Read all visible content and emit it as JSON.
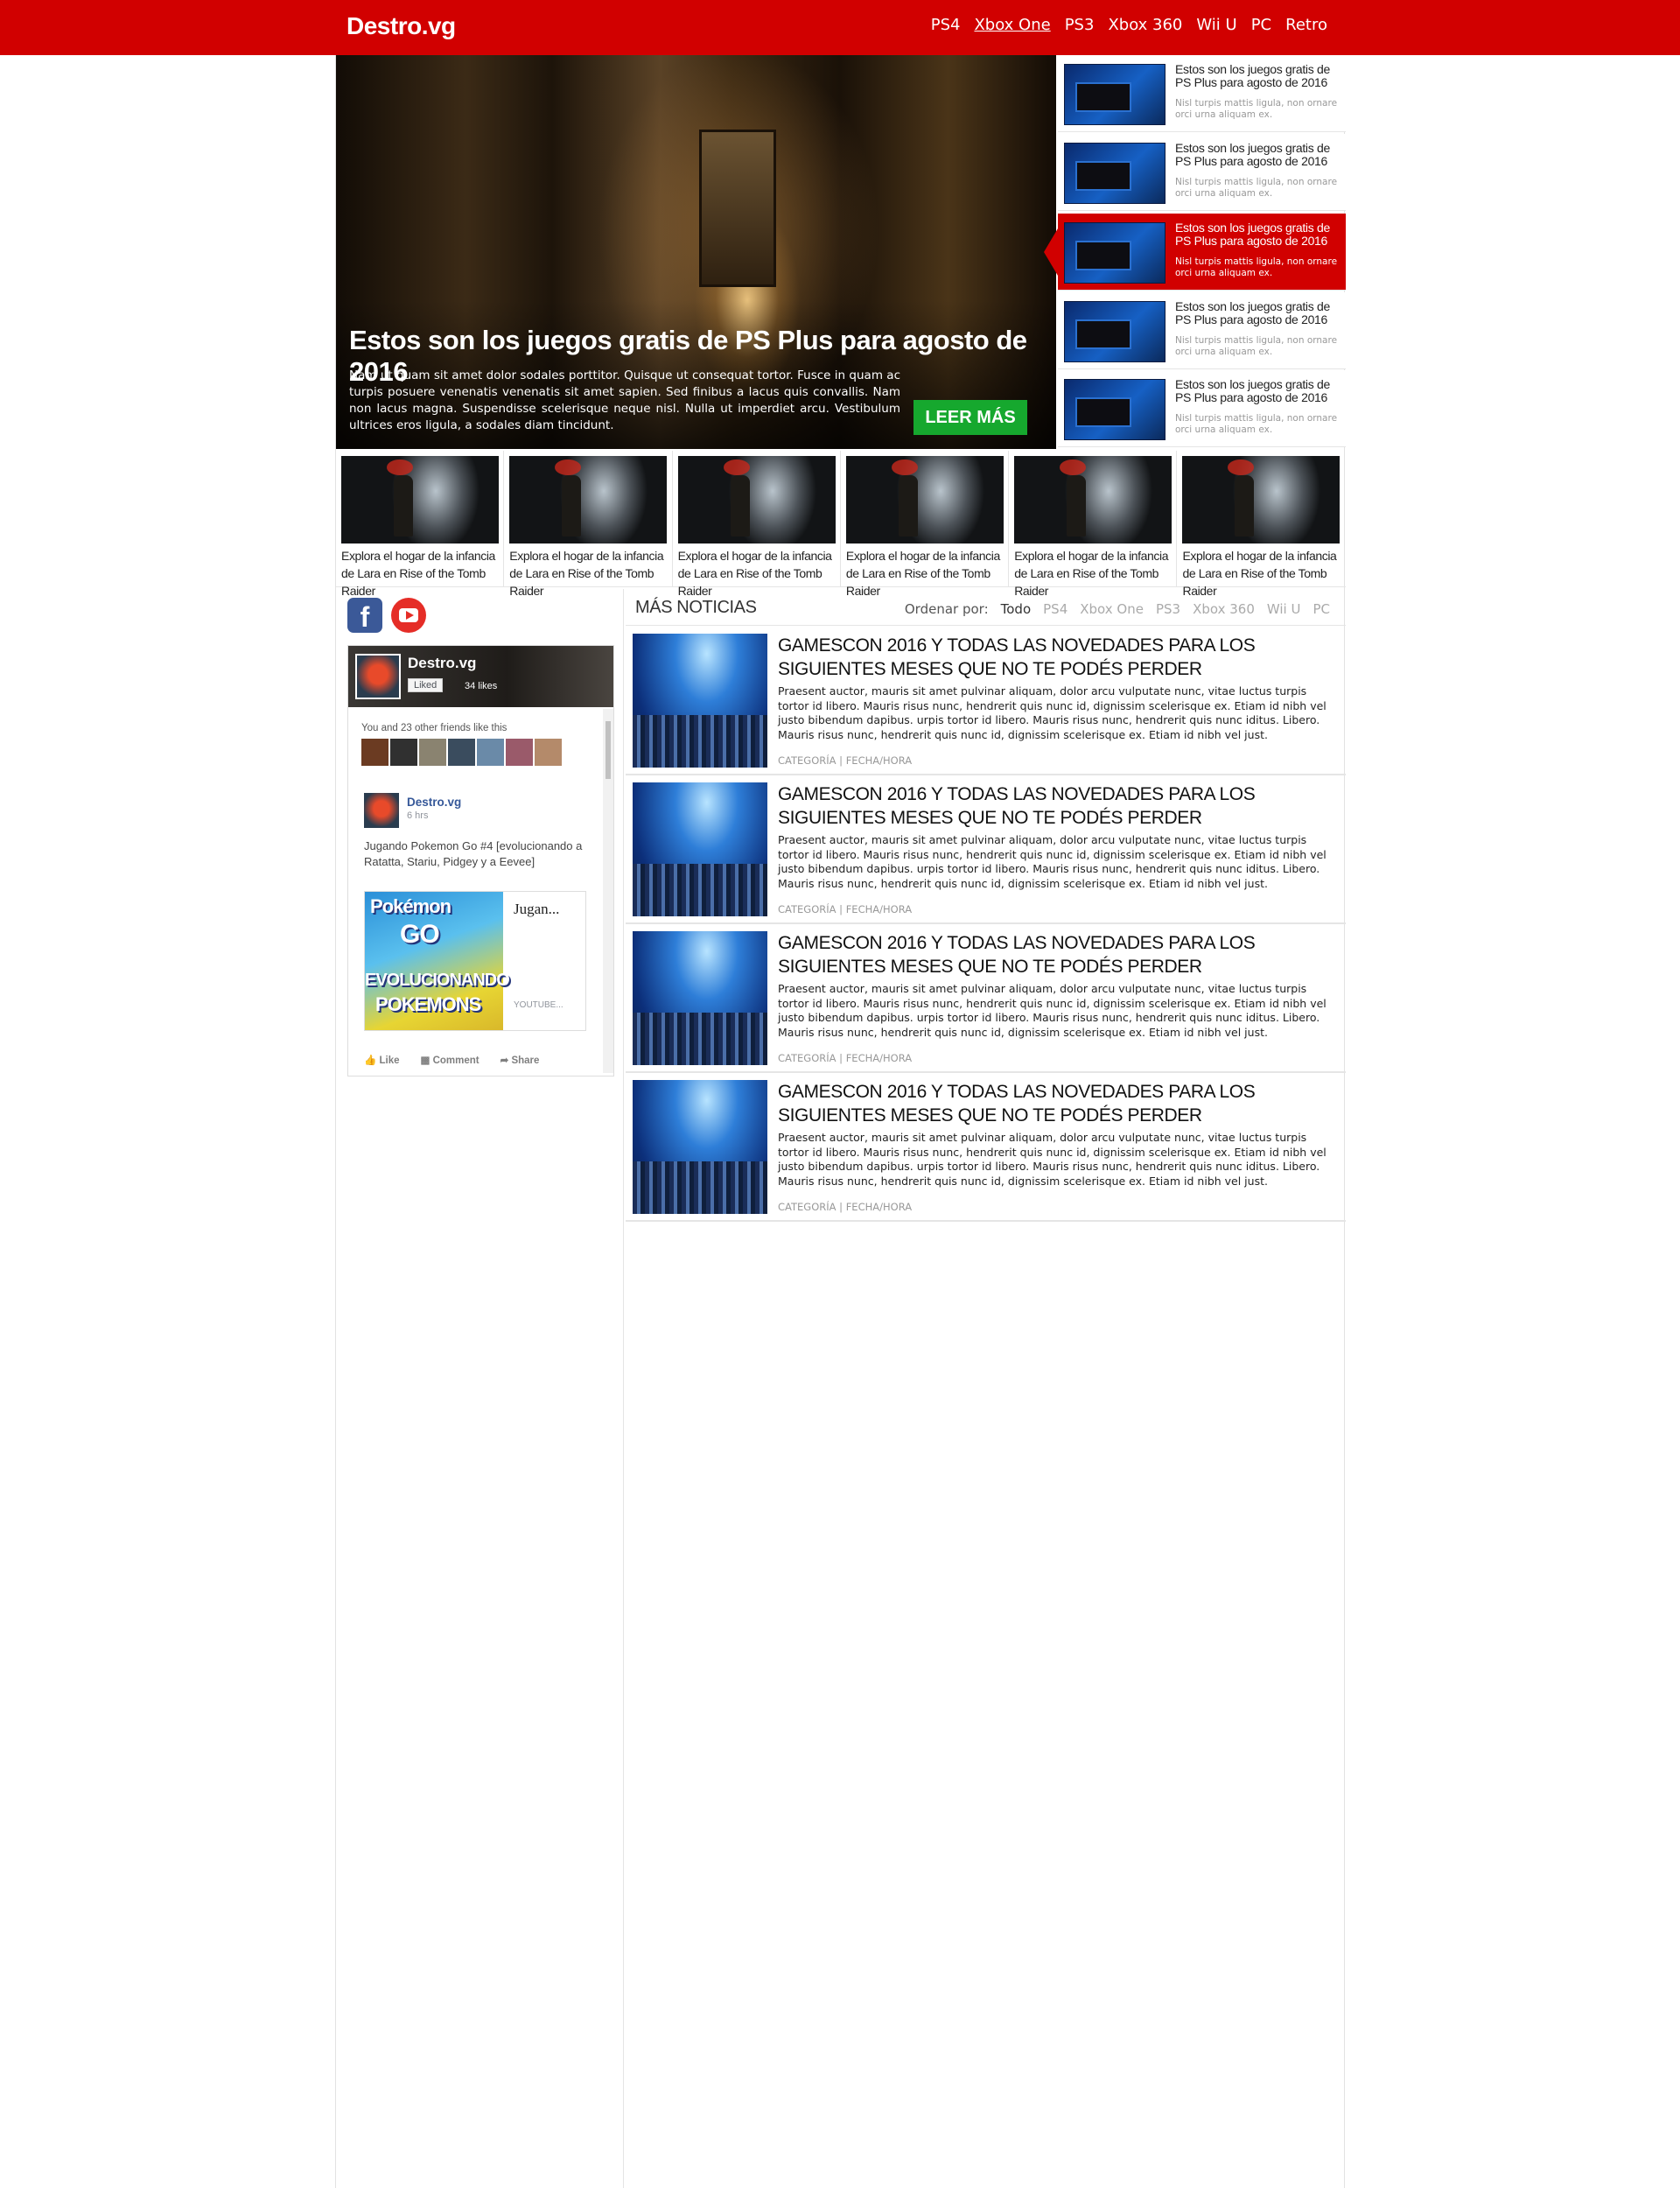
{
  "site": {
    "logo": "Destro.vg"
  },
  "nav": [
    {
      "label": "PS4"
    },
    {
      "label": "Xbox One",
      "active": true
    },
    {
      "label": "PS3"
    },
    {
      "label": "Xbox 360"
    },
    {
      "label": "Wii U"
    },
    {
      "label": "PC"
    },
    {
      "label": "Retro"
    }
  ],
  "hero": {
    "title": "Estos son los juegos gratis de PS Plus para agosto de 2016",
    "text": "Nam ut quam sit amet dolor sodales porttitor. Quisque ut consequat tortor. Fusce in quam ac turpis posuere venenatis venenatis sit amet sapien. Sed finibus a lacus quis convallis. Nam non lacus magna. Suspendisse scelerisque neque nisl. Nulla ut imperdiet arcu. Vestibulum ultrices eros ligula, a sodales diam tincidunt.",
    "button": "LEER MÁS"
  },
  "side_items": [
    {
      "title": "Estos son los juegos gratis de PS Plus para agosto de 2016",
      "desc": "Nisl turpis mattis ligula, non ornare orci urna aliquam ex."
    },
    {
      "title": "Estos son los juegos gratis de PS Plus para agosto de 2016",
      "desc": "Nisl turpis mattis ligula, non ornare orci urna aliquam ex."
    },
    {
      "title": "Estos son los juegos gratis de PS Plus para agosto de 2016",
      "desc": "Nisl turpis mattis ligula, non ornare orci urna aliquam ex.",
      "active": true
    },
    {
      "title": "Estos son los juegos gratis de PS Plus para agosto de 2016",
      "desc": "Nisl turpis mattis ligula, non ornare orci urna aliquam ex."
    },
    {
      "title": "Estos son los juegos gratis de PS Plus para agosto de 2016",
      "desc": "Nisl turpis mattis ligula, non ornare orci urna aliquam ex."
    }
  ],
  "strip": [
    {
      "text": "Explora el hogar de la infancia de Lara en Rise of the Tomb Raider"
    },
    {
      "text": "Explora el hogar de la infancia de Lara en Rise of the Tomb Raider"
    },
    {
      "text": "Explora el hogar de la infancia de Lara en Rise of the Tomb Raider"
    },
    {
      "text": "Explora el hogar de la infancia de Lara en Rise of the Tomb Raider"
    },
    {
      "text": "Explora el hogar de la infancia de Lara en Rise of the Tomb Raider"
    },
    {
      "text": "Explora el hogar de la infancia de Lara en Rise of the Tomb Raider"
    }
  ],
  "social": {
    "facebook_icon": "facebook-icon",
    "youtube_icon": "youtube-icon",
    "fb_letter": "f"
  },
  "fb_widget": {
    "page_name": "Destro.vg",
    "liked": "Liked",
    "likes": "34 likes",
    "friends": "You and 23 other friends like this",
    "post_name": "Destro.vg",
    "post_time": "6 hrs",
    "post_text": "Jugando Pokemon Go #4 [evolucionando a Ratatta, Stariu, Pidgey y a Eevee]",
    "card_title": "Jugan...",
    "card_source": "YOUTUBE...",
    "card_img_line1": "Pokémon",
    "card_img_line2": "GO",
    "card_img_line3": "EVOLUCIONANDO",
    "card_img_line4": "POKEMONS",
    "actions": [
      "Like",
      "Comment",
      "Share"
    ]
  },
  "news": {
    "heading": "MÁS NOTICIAS",
    "sort_label": "Ordenar por:",
    "sort_options": [
      {
        "label": "Todo",
        "active": true
      },
      {
        "label": "PS4"
      },
      {
        "label": "Xbox One"
      },
      {
        "label": "PS3"
      },
      {
        "label": "Xbox 360"
      },
      {
        "label": "Wii U"
      },
      {
        "label": "PC"
      }
    ],
    "articles": [
      {
        "title": "Gamescon 2016 y todas las novedades para los siguientes meses que no te podés perder",
        "text": "Praesent auctor, mauris sit amet pulvinar aliquam, dolor arcu vulputate nunc, vitae luctus turpis tortor id libero. Mauris risus nunc, hendrerit quis nunc id, dignissim scelerisque ex. Etiam id nibh vel justo bibendum dapibus. urpis tortor id libero. Mauris risus nunc, hendrerit quis nunc iditus. Libero. Mauris risus nunc, hendrerit quis nunc id, dignissim scelerisque ex. Etiam id nibh vel just.",
        "meta": "CATEGORÍA | FECHA/HORA"
      },
      {
        "title": "Gamescon 2016 y todas las novedades para los siguientes meses que no te podés perder",
        "text": "Praesent auctor, mauris sit amet pulvinar aliquam, dolor arcu vulputate nunc, vitae luctus turpis tortor id libero. Mauris risus nunc, hendrerit quis nunc id, dignissim scelerisque ex. Etiam id nibh vel justo bibendum dapibus. urpis tortor id libero. Mauris risus nunc, hendrerit quis nunc iditus. Libero. Mauris risus nunc, hendrerit quis nunc id, dignissim scelerisque ex. Etiam id nibh vel just.",
        "meta": "CATEGORÍA | FECHA/HORA"
      },
      {
        "title": "Gamescon 2016 y todas las novedades para los siguientes meses que no te podés perder",
        "text": "Praesent auctor, mauris sit amet pulvinar aliquam, dolor arcu vulputate nunc, vitae luctus turpis tortor id libero. Mauris risus nunc, hendrerit quis nunc id, dignissim scelerisque ex. Etiam id nibh vel justo bibendum dapibus. urpis tortor id libero. Mauris risus nunc, hendrerit quis nunc iditus. Libero. Mauris risus nunc, hendrerit quis nunc id, dignissim scelerisque ex. Etiam id nibh vel just.",
        "meta": "CATEGORÍA | FECHA/HORA"
      },
      {
        "title": "Gamescon 2016 y todas las novedades para los siguientes meses que no te podés perder",
        "text": "Praesent auctor, mauris sit amet pulvinar aliquam, dolor arcu vulputate nunc, vitae luctus turpis tortor id libero. Mauris risus nunc, hendrerit quis nunc id, dignissim scelerisque ex. Etiam id nibh vel justo bibendum dapibus. urpis tortor id libero. Mauris risus nunc, hendrerit quis nunc iditus. Libero. Mauris risus nunc, hendrerit quis nunc id, dignissim scelerisque ex. Etiam id nibh vel just.",
        "meta": "CATEGORÍA | FECHA/HORA"
      }
    ]
  },
  "colors": {
    "brand_red": "#d10000",
    "button_green": "#16a82e",
    "fb_blue": "#3b5998",
    "yt_red": "#e52d27"
  }
}
